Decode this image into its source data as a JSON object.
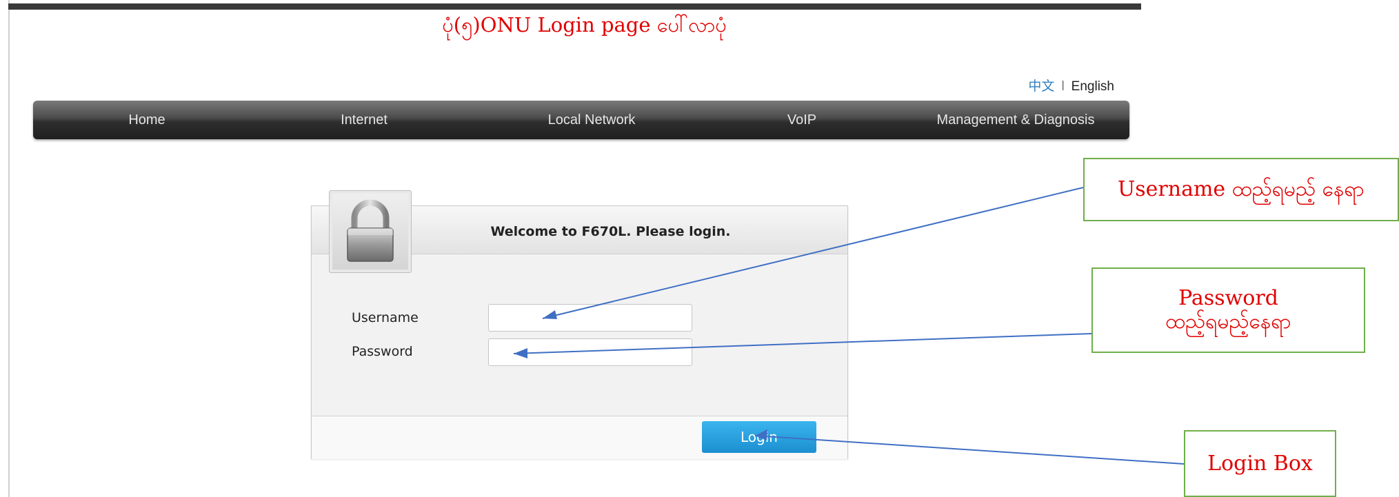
{
  "caption": {
    "title": "ပုံ(၅)ONU Login page ပေါ်လာပုံ"
  },
  "language": {
    "chinese": "中文",
    "separator": "l",
    "english": "English"
  },
  "nav": {
    "items": [
      {
        "label": "Home"
      },
      {
        "label": "Internet"
      },
      {
        "label": "Local Network"
      },
      {
        "label": "VoIP"
      },
      {
        "label": "Management & Diagnosis"
      }
    ]
  },
  "login": {
    "title": "Welcome to F670L. Please login.",
    "username_label": "Username",
    "password_label": "Password",
    "username_value": "",
    "password_value": "",
    "button_label": "Login"
  },
  "annotations": {
    "username_note": "Username ထည့်ရမည့် နေရာ",
    "password_note_line1": "Password",
    "password_note_line2": "ထည့်ရမည့်နေရာ",
    "login_note": "Login Box"
  },
  "colors": {
    "annotation_text": "#e00000",
    "annotation_border": "#6fae4a",
    "arrow": "#3f6fc4",
    "login_button": "#1c8fd0"
  },
  "icons": [
    "lock-icon"
  ]
}
